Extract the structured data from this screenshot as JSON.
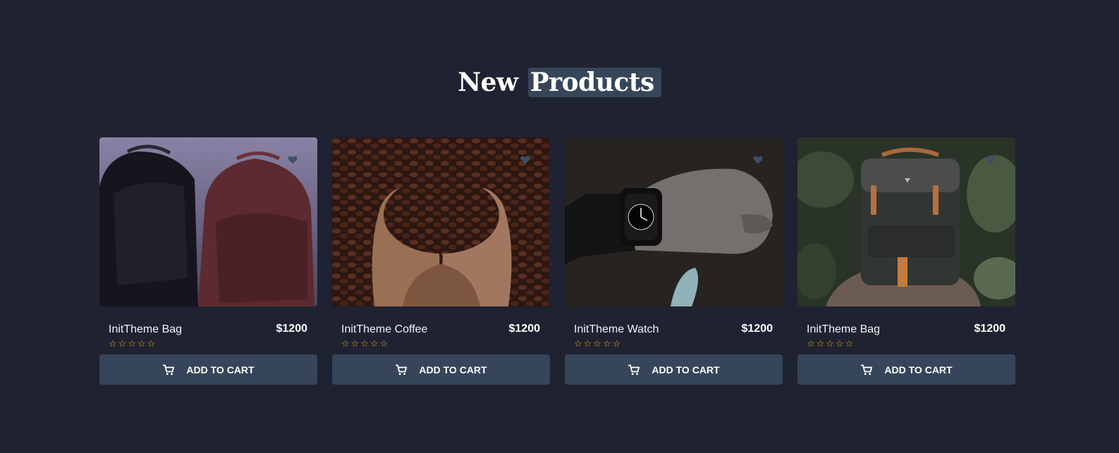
{
  "section": {
    "title_plain": "New",
    "title_highlight": "Products"
  },
  "products": [
    {
      "name": "InitTheme Bag",
      "price": "$1200",
      "rating_stars": "☆☆☆☆☆",
      "button_label": "ADD TO CART",
      "image": "two backpacks (black and maroon)"
    },
    {
      "name": "InitTheme Coffee",
      "price": "$1200",
      "rating_stars": "☆☆☆☆☆",
      "button_label": "ADD TO CART",
      "image": "hands holding coffee beans"
    },
    {
      "name": "InitTheme Watch",
      "price": "$1200",
      "rating_stars": "☆☆☆☆☆",
      "button_label": "ADD TO CART",
      "image": "wrist wearing smartwatch"
    },
    {
      "name": "InitTheme Bag",
      "price": "$1200",
      "rating_stars": "☆☆☆☆☆",
      "button_label": "ADD TO CART",
      "image": "green backpack on rock"
    }
  ],
  "icons": {
    "wishlist": "heart-icon",
    "cart": "cart-icon",
    "star": "star-outline-icon"
  },
  "colors": {
    "background": "#1f2230",
    "accent": "#364559",
    "star": "#e8a91c",
    "text": "#ffffff"
  }
}
